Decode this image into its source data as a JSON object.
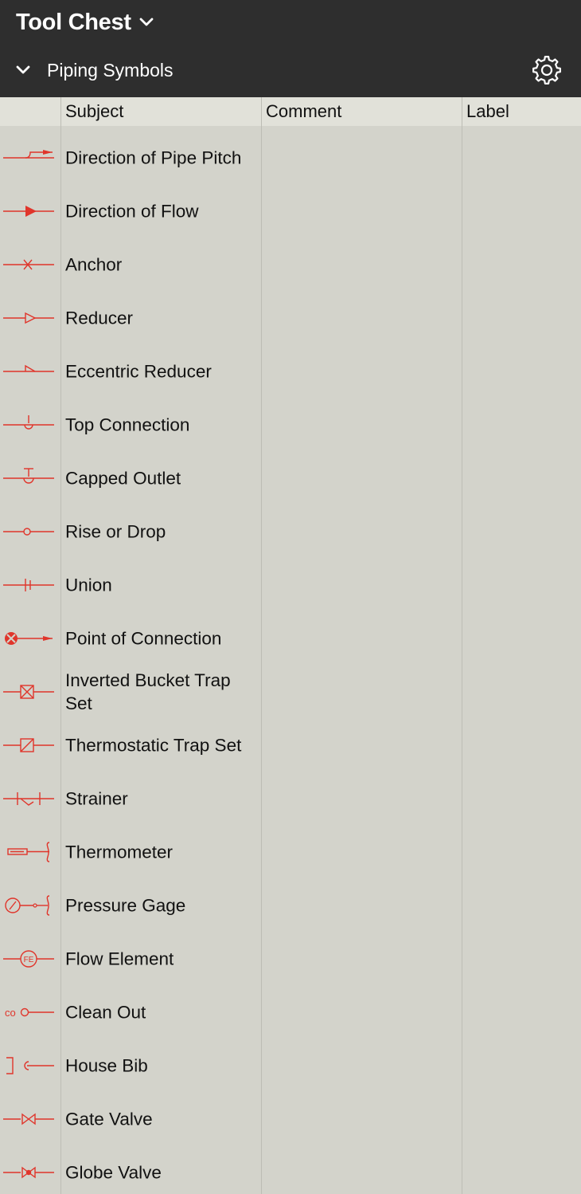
{
  "header": {
    "title": "Tool Chest",
    "section": "Piping Symbols"
  },
  "columns": {
    "subject": "Subject",
    "comment": "Comment",
    "label": "Label"
  },
  "colors": {
    "header_bg": "#2e2e2e",
    "body_bg": "#d3d3cb",
    "symbol": "#e0352b"
  },
  "rows": [
    {
      "subject": "Direction of Pipe Pitch",
      "icon": "pipe-pitch-icon"
    },
    {
      "subject": "Direction of Flow",
      "icon": "flow-direction-icon"
    },
    {
      "subject": "Anchor",
      "icon": "anchor-icon"
    },
    {
      "subject": "Reducer",
      "icon": "reducer-icon"
    },
    {
      "subject": "Eccentric Reducer",
      "icon": "eccentric-reducer-icon"
    },
    {
      "subject": "Top Connection",
      "icon": "top-connection-icon"
    },
    {
      "subject": "Capped Outlet",
      "icon": "capped-outlet-icon"
    },
    {
      "subject": "Rise or Drop",
      "icon": "rise-or-drop-icon"
    },
    {
      "subject": "Union",
      "icon": "union-icon"
    },
    {
      "subject": "Point of Connection",
      "icon": "point-of-connection-icon"
    },
    {
      "subject": "Inverted Bucket Trap Set",
      "icon": "inverted-bucket-trap-icon"
    },
    {
      "subject": "Thermostatic Trap Set",
      "icon": "thermostatic-trap-icon"
    },
    {
      "subject": "Strainer",
      "icon": "strainer-icon"
    },
    {
      "subject": "Thermometer",
      "icon": "thermometer-icon"
    },
    {
      "subject": "Pressure Gage",
      "icon": "pressure-gage-icon"
    },
    {
      "subject": "Flow Element",
      "icon": "flow-element-icon"
    },
    {
      "subject": "Clean Out",
      "icon": "clean-out-icon"
    },
    {
      "subject": "House Bib",
      "icon": "house-bib-icon"
    },
    {
      "subject": "Gate Valve",
      "icon": "gate-valve-icon"
    },
    {
      "subject": "Globe Valve",
      "icon": "globe-valve-icon"
    }
  ]
}
